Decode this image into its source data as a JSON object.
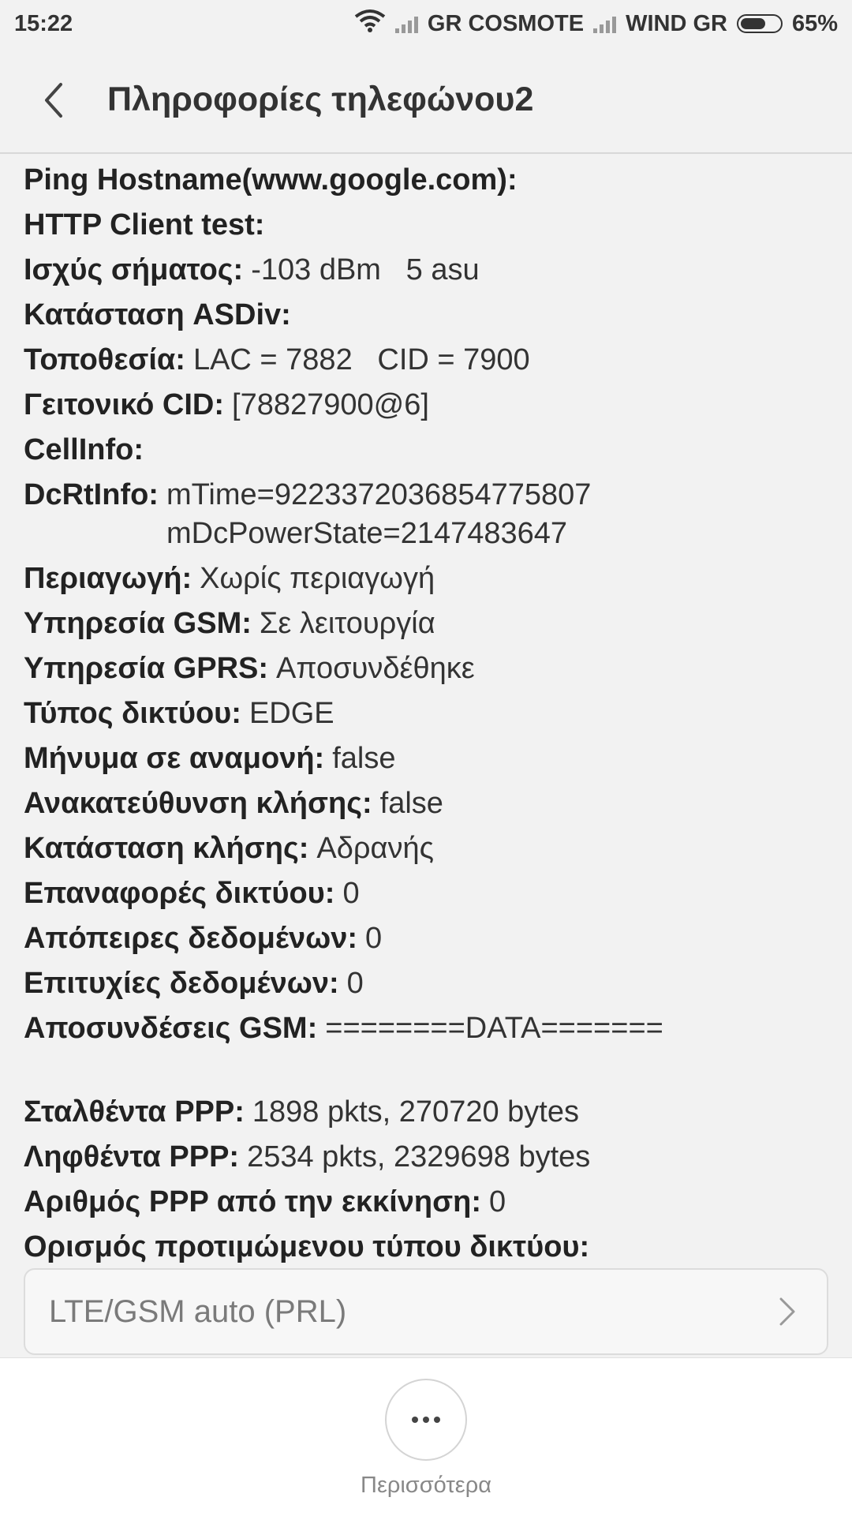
{
  "status_bar": {
    "time": "15:22",
    "carrier1": "GR COSMOTE",
    "carrier2": "WIND GR",
    "battery": "65%"
  },
  "header": {
    "title": "Πληροφορίες τηλεφώνου2"
  },
  "info": {
    "ping": {
      "key": "Ping Hostname(www.google.com):",
      "value": ""
    },
    "http": {
      "key": "HTTP Client test:",
      "value": ""
    },
    "signal": {
      "key": "Ισχύς σήματος:",
      "value": "-103 dBm   5 asu"
    },
    "asdiv": {
      "key": "Κατάσταση ASDiv:",
      "value": ""
    },
    "location": {
      "key": "Τοποθεσία:",
      "value": "LAC = 7882   CID = 7900"
    },
    "neighbor": {
      "key": "Γειτονικό CID:",
      "value": "[78827900@6]"
    },
    "cellinfo": {
      "key": "CellInfo:",
      "value": ""
    },
    "dcrt": {
      "key": "DcRtInfo:",
      "value": "mTime=9223372036854775807\nmDcPowerState=2147483647"
    },
    "roaming": {
      "key": "Περιαγωγή:",
      "value": "Χωρίς περιαγωγή"
    },
    "gsm": {
      "key": "Υπηρεσία GSM:",
      "value": "Σε λειτουργία"
    },
    "gprs": {
      "key": "Υπηρεσία GPRS:",
      "value": "Αποσυνδέθηκε"
    },
    "nettype": {
      "key": "Τύπος δικτύου:",
      "value": "EDGE"
    },
    "msgwait": {
      "key": "Μήνυμα σε αναμονή:",
      "value": "false"
    },
    "callfwd": {
      "key": "Ανακατεύθυνση κλήσης:",
      "value": "false"
    },
    "callstate": {
      "key": "Κατάσταση κλήσης:",
      "value": "Αδρανής"
    },
    "netresets": {
      "key": "Επαναφορές δικτύου:",
      "value": "0"
    },
    "dataattempts": {
      "key": "Απόπειρες δεδομένων:",
      "value": "0"
    },
    "datasuccess": {
      "key": "Επιτυχίες δεδομένων:",
      "value": "0"
    },
    "gsmdisc": {
      "key": "Αποσυνδέσεις GSM:",
      "value": "========DATA======="
    },
    "pppsent": {
      "key": "Σταλθέντα PPP:",
      "value": "1898 pkts, 270720 bytes"
    },
    "ppprecv": {
      "key": "Ληφθέντα PPP:",
      "value": "2534 pkts, 2329698 bytes"
    },
    "pppcount": {
      "key": "Αριθμός PPP από την εκκίνηση:",
      "value": "0"
    },
    "preferred": {
      "key": "Ορισμός προτιμώμενου τύπου δικτύου:",
      "value": ""
    }
  },
  "network_select": {
    "value": "LTE/GSM auto (PRL)"
  },
  "bottom": {
    "more_label": "Περισσότερα"
  },
  "icons": {
    "wifi": "wifi-icon",
    "signal": "signal-icon",
    "battery": "battery-icon",
    "back": "back-arrow-icon",
    "chevron": "chevron-right-icon",
    "more": "more-dots-icon"
  }
}
